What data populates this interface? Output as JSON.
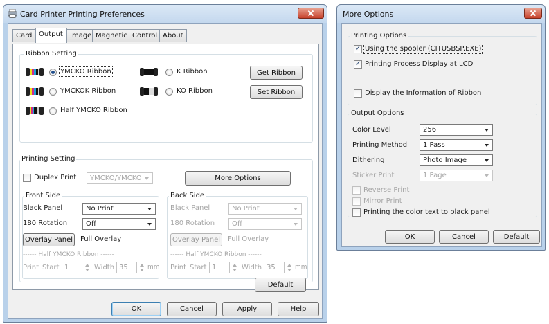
{
  "left_window": {
    "title": "Card Printer Printing Preferences",
    "tabs": [
      "Card",
      "Output",
      "Image",
      "Magnetic",
      "Control",
      "About"
    ],
    "active_tab": "Output",
    "ribbon_setting": {
      "label": "Ribbon Setting",
      "options": [
        {
          "label": "YMCKO Ribbon",
          "selected": true
        },
        {
          "label": "YMCKOK Ribbon",
          "selected": false
        },
        {
          "label": "Half YMCKO Ribbon",
          "selected": false
        },
        {
          "label": "K Ribbon",
          "selected": false
        },
        {
          "label": "KO Ribbon",
          "selected": false
        }
      ],
      "get_ribbon": "Get Ribbon",
      "set_ribbon": "Set Ribbon"
    },
    "printing_setting": {
      "label": "Printing Setting",
      "duplex_label": "Duplex Print",
      "duplex_value": "YMCKO/YMCKO",
      "more_options": "More Options"
    },
    "front_side": {
      "label": "Front Side",
      "black_panel_label": "Black Panel",
      "black_panel_value": "No Print",
      "rotation_label": "180 Rotation",
      "rotation_value": "Off",
      "overlay_button": "Overlay Panel",
      "overlay_value": "Full Overlay",
      "half_label": "------ Half YMCKO Ribbon ------",
      "print_label": "Print",
      "start_label": "Start",
      "start_value": "1",
      "width_label": "Width",
      "width_value": "35",
      "unit": "mm"
    },
    "back_side": {
      "label": "Back Side",
      "black_panel_label": "Black Panel",
      "black_panel_value": "No Print",
      "rotation_label": "180 Rotation",
      "rotation_value": "Off",
      "overlay_button": "Overlay Panel",
      "overlay_value": "Full Overlay",
      "half_label": "------ Half YMCKO Ribbon ------",
      "print_label": "Print",
      "start_label": "Start",
      "start_value": "1",
      "width_label": "Width",
      "width_value": "35",
      "unit": "mm"
    },
    "buttons": {
      "default": "Default",
      "ok": "OK",
      "cancel": "Cancel",
      "apply": "Apply",
      "help": "Help"
    }
  },
  "right_window": {
    "title": "More Options",
    "printing_options": {
      "label": "Printing Options",
      "spooler": "Using the spooler (CITUSBSP.EXE)",
      "lcd": "Printing Process Display at LCD",
      "ribbon_info": "Display the Information of Ribbon"
    },
    "output_options": {
      "label": "Output Options",
      "color_level_label": "Color Level",
      "color_level_value": "256",
      "method_label": "Printing Method",
      "method_value": "1 Pass",
      "dithering_label": "Dithering",
      "dithering_value": "Photo Image",
      "sticker_label": "Sticker Print",
      "sticker_value": "1 Page",
      "reverse": "Reverse Print",
      "mirror": "Mirror Print",
      "color_text": "Printing the color text to black panel"
    },
    "buttons": {
      "ok": "OK",
      "cancel": "Cancel",
      "default": "Default"
    }
  }
}
